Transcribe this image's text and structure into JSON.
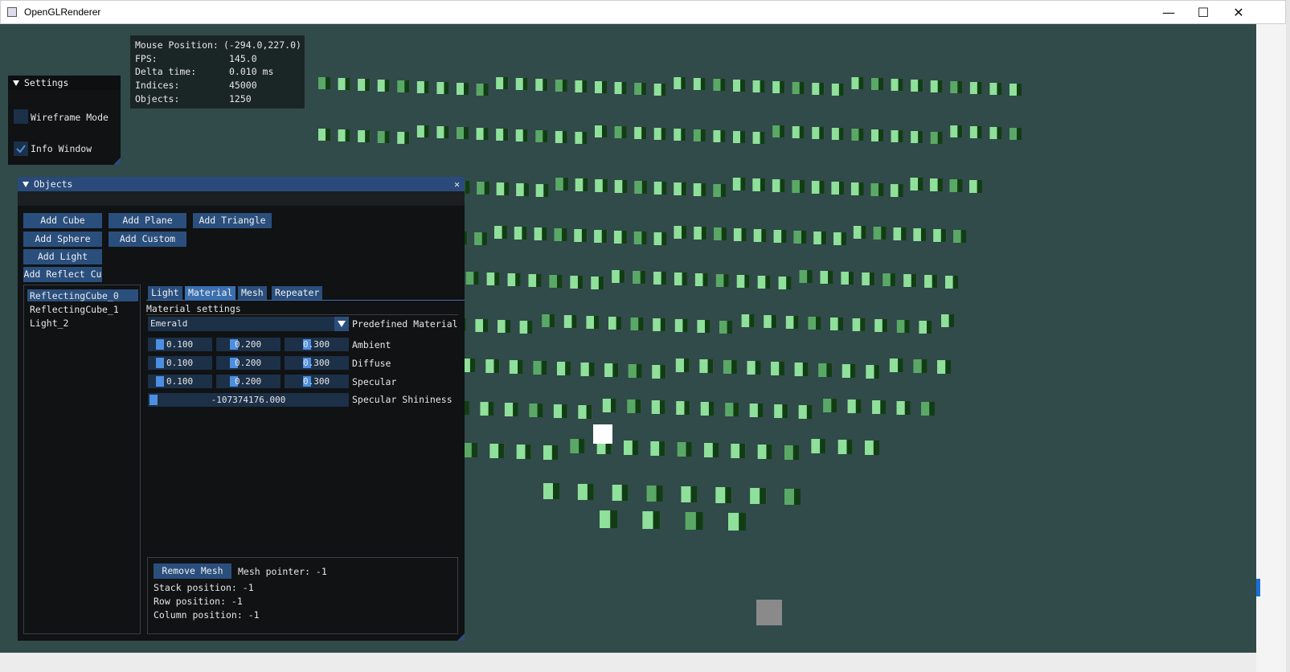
{
  "window": {
    "title": "OpenGLRenderer",
    "minimize": "—",
    "maximize": "☐",
    "close": "✕"
  },
  "info": {
    "rows": [
      {
        "label": "Mouse Position:",
        "value": "(-294.0,227.0)"
      },
      {
        "label": "FPS:",
        "value": "145.0"
      },
      {
        "label": "Delta time:",
        "value": "0.010 ms"
      },
      {
        "label": "Indices:",
        "value": "45000"
      },
      {
        "label": "Objects:",
        "value": "1250"
      }
    ]
  },
  "settings": {
    "title": "Settings",
    "wireframe_label": "Wireframe Mode",
    "wireframe_checked": false,
    "info_label": "Info Window",
    "info_checked": true
  },
  "objects": {
    "title": "Objects",
    "close": "✕",
    "buttons": {
      "add_cube": "Add Cube",
      "add_plane": "Add Plane",
      "add_triangle": "Add Triangle",
      "add_sphere": "Add Sphere",
      "add_custom": "Add Custom",
      "add_light": "Add Light",
      "add_reflect": "Add Reflect Cu"
    },
    "list": [
      "ReflectingCube_0",
      "ReflectingCube_1",
      "Light_2"
    ],
    "selected_index": 0,
    "tabs": [
      "Light",
      "Material",
      "Mesh",
      "Repeater"
    ],
    "active_tab": "Material",
    "section_label": "Material settings",
    "material": {
      "predefined_value": "Emerald",
      "predefined_label": "Predefined Material",
      "ambient": {
        "label": "Ambient",
        "values": [
          "0.100",
          "0.200",
          "0.300"
        ]
      },
      "diffuse": {
        "label": "Diffuse",
        "values": [
          "0.100",
          "0.200",
          "0.300"
        ]
      },
      "specular": {
        "label": "Specular",
        "values": [
          "0.100",
          "0.200",
          "0.300"
        ]
      },
      "shininess": {
        "label": "Specular Shininess",
        "value": "-107374176.000"
      }
    },
    "mesh": {
      "remove_button": "Remove Mesh",
      "pointer": "Mesh pointer: -1",
      "stack": "Stack position:  -1",
      "row": "Row position:    -1",
      "column": "Column position: -1"
    }
  },
  "colors": {
    "viewport_bg": "#314a4a",
    "panel_bg": "#101214",
    "title_active": "#294a7a",
    "button": "#2a4f7d",
    "cube_light": "#8fe09a",
    "cube_dark": "#123d14"
  }
}
